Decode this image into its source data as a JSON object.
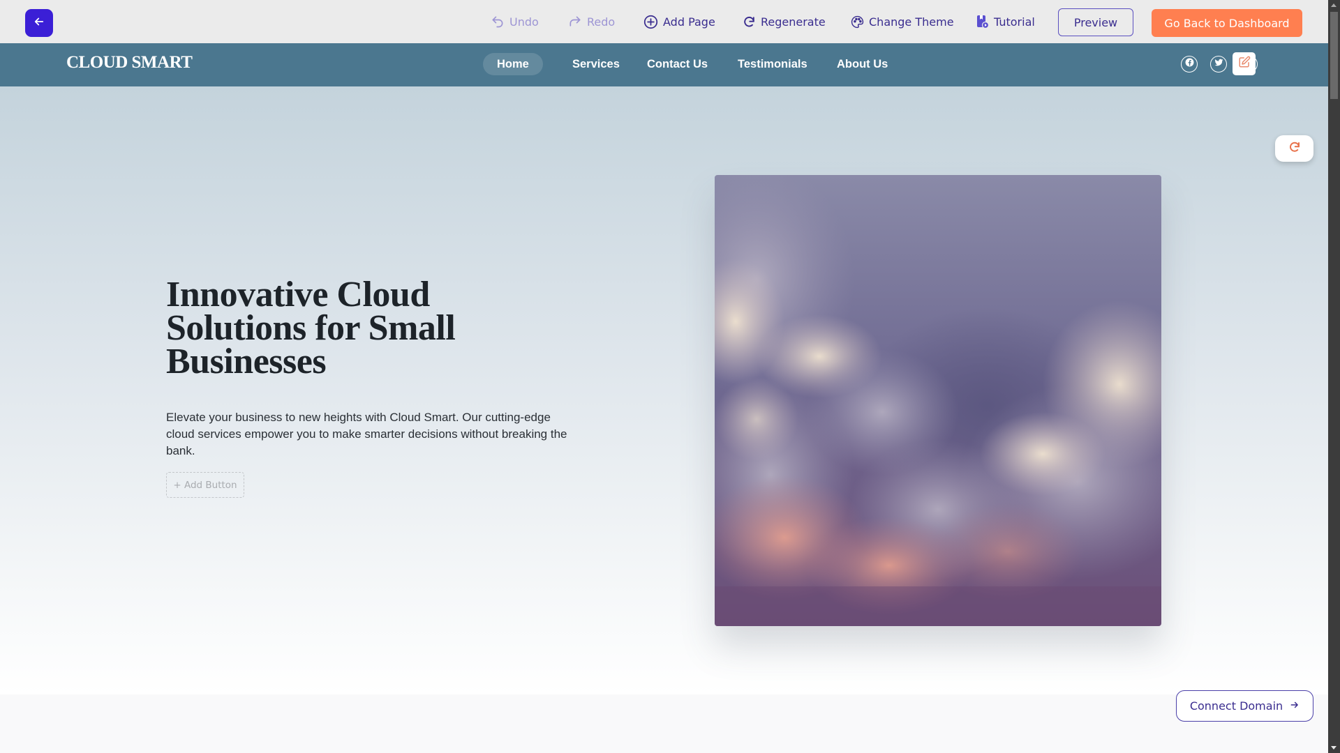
{
  "editor_toolbar": {
    "back_icon": "arrow-left-icon",
    "undo_label": "Undo",
    "redo_label": "Redo",
    "add_page_label": "Add Page",
    "regenerate_label": "Regenerate",
    "change_theme_label": "Change Theme",
    "tutorial_label": "Tutorial",
    "preview_label": "Preview",
    "dashboard_label": "Go Back to Dashboard",
    "accent_color": "#3b1fd6",
    "cta_color": "#ff7f50"
  },
  "site_nav": {
    "logo": "CLOUD SMART",
    "links": [
      "Home",
      "Services",
      "Contact Us",
      "Testimonials",
      "About Us"
    ],
    "active": "Home",
    "social_icons": [
      "facebook-icon",
      "twitter-icon"
    ],
    "edit_icon": "edit-icon",
    "bg_color": "#4b778f"
  },
  "hero": {
    "title": "Innovative Cloud Solutions for Small Businesses",
    "description": "Elevate your business to new heights with Cloud Smart. Our cutting-edge cloud services empower you to make smarter decisions without breaking the bank.",
    "add_button_label": "+ Add Button",
    "image_alt": "Sunset clouds",
    "refresh_icon": "refresh-icon"
  },
  "footer_actions": {
    "connect_domain_label": "Connect Domain"
  }
}
